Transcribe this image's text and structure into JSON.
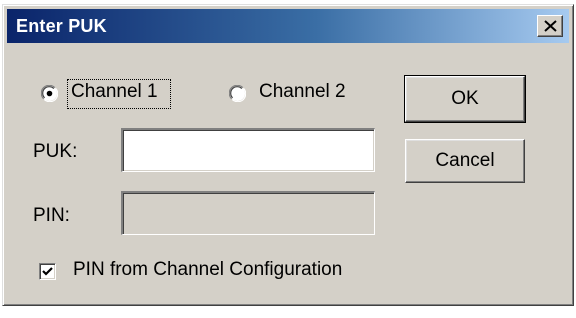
{
  "window": {
    "title": "Enter PUK"
  },
  "icons": {
    "close": "close-icon",
    "check": "check-icon"
  },
  "channels": {
    "channel1_label": "Channel 1",
    "channel2_label": "Channel 2",
    "selected": "Channel 1"
  },
  "fields": {
    "puk_label": "PUK:",
    "puk_value": "",
    "pin_label": "PIN:",
    "pin_value": "",
    "pin_enabled": false
  },
  "options": {
    "pin_from_config_label": "PIN from Channel Configuration",
    "pin_from_config_checked": true
  },
  "buttons": {
    "ok_label": "OK",
    "cancel_label": "Cancel"
  },
  "colors": {
    "title_gradient_start": "#0a246a",
    "title_gradient_end": "#a6caf0",
    "face": "#d4d0c8"
  }
}
